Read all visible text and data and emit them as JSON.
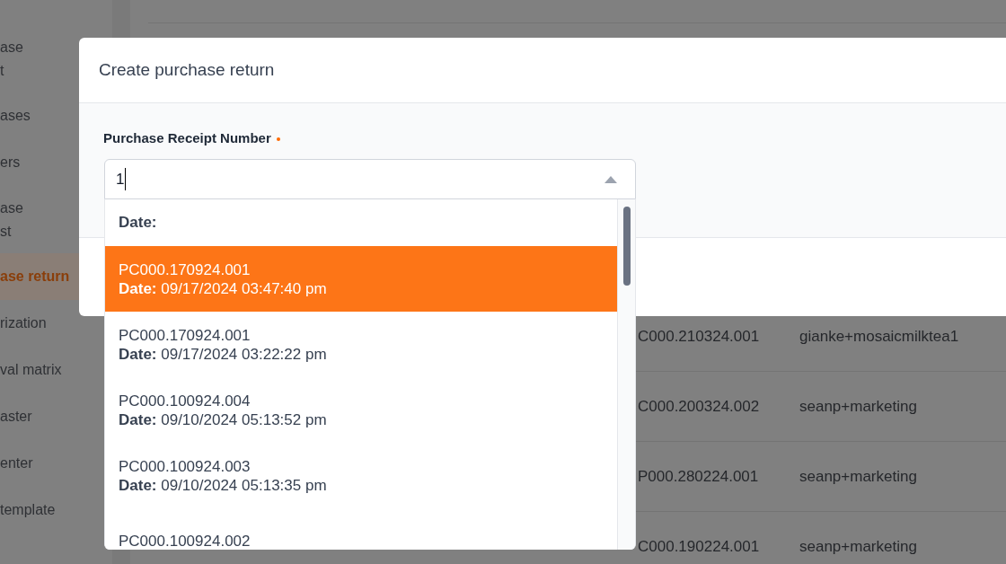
{
  "sidebar": {
    "items": [
      {
        "label": "ase\nt",
        "selected": false
      },
      {
        "label": "ases",
        "selected": false
      },
      {
        "label": "ers",
        "selected": false
      },
      {
        "label": "ase\nst",
        "selected": false
      },
      {
        "label": "ase return",
        "selected": true
      },
      {
        "label": "rization",
        "selected": false
      },
      {
        "label": "val matrix",
        "selected": false
      },
      {
        "label": "aster",
        "selected": false
      },
      {
        "label": "enter",
        "selected": false
      },
      {
        "label": "template",
        "selected": false
      }
    ]
  },
  "table": {
    "rows": [
      {
        "column_1": "C000.210324.001",
        "column_2": "gianke+mosaicmilktea1"
      },
      {
        "column_1": "C000.200324.002",
        "column_2": "seanp+marketing"
      },
      {
        "column_1": "P000.280224.001",
        "column_2": "seanp+marketing"
      },
      {
        "column_1": "C000.190224.001",
        "column_2": "seanp+marketing"
      }
    ]
  },
  "dialog": {
    "title": "Create purchase return",
    "field": {
      "label": "Purchase Receipt Number",
      "required": true,
      "value": "1",
      "expanded": true
    },
    "dropdown": {
      "group_label": "Date:",
      "options": [
        {
          "number": "PC000.170924.001",
          "date": "**Date:** 09/17/2024 03:47:40 pm",
          "selected": true
        },
        {
          "number": "PC000.170924.001",
          "date": "**Date:** 09/17/2024 03:22:22 pm",
          "selected": false
        },
        {
          "number": "PC000.100924.004",
          "date": "**Date:** 09/10/2024 05:13:52 pm",
          "selected": false
        },
        {
          "number": "PC000.100924.003",
          "date": "**Date:** 09/10/2024 05:13:35 pm",
          "selected": false
        },
        {
          "number": "PC000.100924.002",
          "selected": false
        }
      ]
    }
  }
}
